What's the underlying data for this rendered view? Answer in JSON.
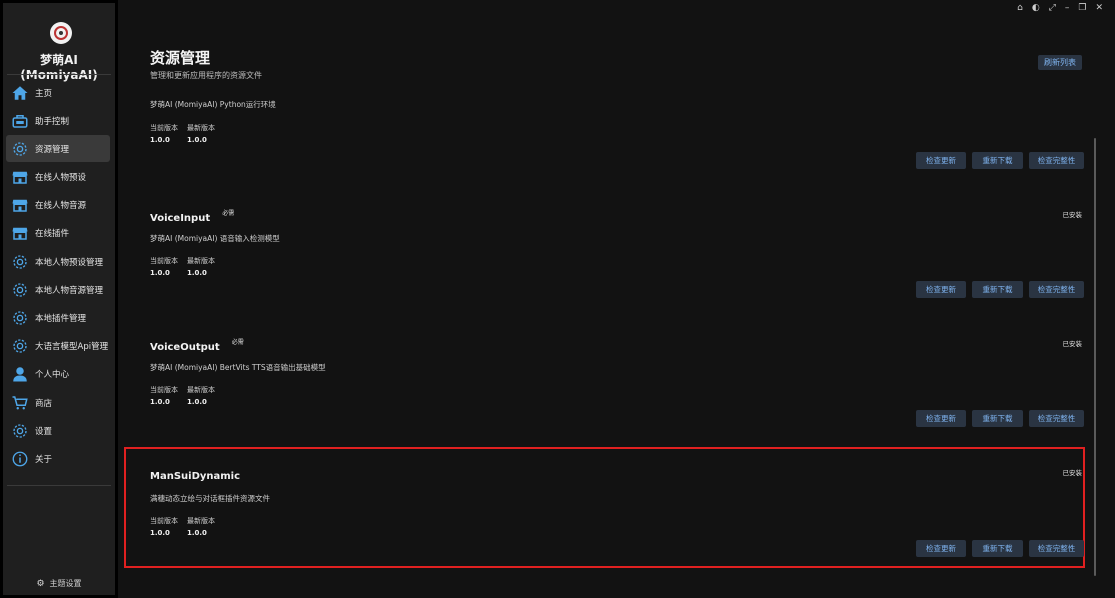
{
  "app": {
    "name": "梦萌AI (MomiyaAI)"
  },
  "sidebar": {
    "items": [
      {
        "label": "主页",
        "icon": "home-icon"
      },
      {
        "label": "助手控制",
        "icon": "assistant-icon"
      },
      {
        "label": "资源管理",
        "icon": "gear-icon",
        "active": true
      },
      {
        "label": "在线人物预设",
        "icon": "store-icon"
      },
      {
        "label": "在线人物音源",
        "icon": "store-icon"
      },
      {
        "label": "在线插件",
        "icon": "store-icon"
      },
      {
        "label": "本地人物预设管理",
        "icon": "gear-icon"
      },
      {
        "label": "本地人物音源管理",
        "icon": "gear-icon"
      },
      {
        "label": "本地插件管理",
        "icon": "gear-icon"
      },
      {
        "label": "大语言模型Api管理",
        "icon": "gear-icon"
      },
      {
        "label": "个人中心",
        "icon": "user-icon"
      },
      {
        "label": "商店",
        "icon": "cart-icon"
      },
      {
        "label": "设置",
        "icon": "gear-icon"
      },
      {
        "label": "关于",
        "icon": "info-icon"
      }
    ],
    "theme_label": "主题设置"
  },
  "header": {
    "title": "资源管理",
    "subtitle": "管理和更新应用程序的资源文件",
    "refresh_label": "刷新列表"
  },
  "labels": {
    "current_version": "当前版本",
    "latest_version": "最新版本",
    "check_update": "检查更新",
    "redownload": "重新下载",
    "check_integrity": "检查完整性"
  },
  "resources": [
    {
      "name": "",
      "required": "",
      "status": "",
      "description": "梦萌AI (MomiyaAI) Python运行环境",
      "current": "1.0.0",
      "latest": "1.0.0"
    },
    {
      "name": "VoiceInput",
      "required": "必需",
      "status": "已安装",
      "description": "梦萌AI (MomiyaAI) 语音输入检测模型",
      "current": "1.0.0",
      "latest": "1.0.0"
    },
    {
      "name": "VoiceOutput",
      "required": "必需",
      "status": "已安装",
      "description": "梦萌AI (MomiyaAI) BertVits TTS语音输出基础模型",
      "current": "1.0.0",
      "latest": "1.0.0"
    },
    {
      "name": "ManSuiDynamic",
      "required": "",
      "status": "已安装",
      "description": "满穗动态立绘与对话框插件资源文件",
      "current": "1.0.0",
      "latest": "1.0.0"
    }
  ],
  "colors": {
    "accent": "#4ea6e8",
    "button_bg": "#2a3442",
    "button_text": "#7fb3ef",
    "highlight": "#e02020"
  }
}
